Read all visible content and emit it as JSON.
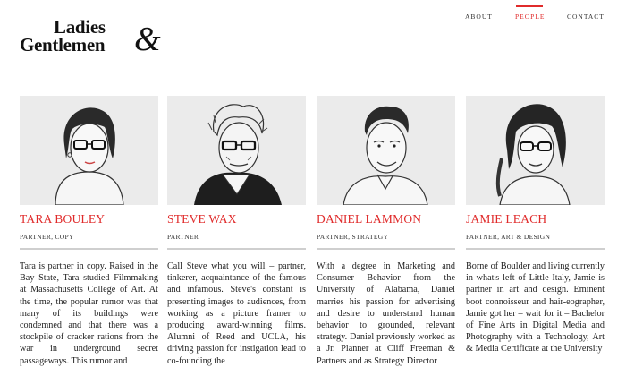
{
  "brand": {
    "line1": "Ladies",
    "line2": "Gentlemen",
    "amp": "&"
  },
  "nav": {
    "items": [
      {
        "label": "ABOUT",
        "active": false
      },
      {
        "label": "PEOPLE",
        "active": true
      },
      {
        "label": "CONTACT",
        "active": false
      }
    ]
  },
  "people": [
    {
      "name": "TARA BOULEY",
      "role": "PARTNER, COPY",
      "bio": "Tara is partner in copy. Raised in the Bay State, Tara studied Filmmaking at Massachusetts College of Art. At the time, the popular rumor was that many of its buildings were condemned and that there was a stockpile of cracker rations from the war in underground secret passageways. This rumor and"
    },
    {
      "name": "STEVE WAX",
      "role": "PARTNER",
      "bio": "Call Steve what you will – partner, tinkerer, acquaintance of the famous and infamous. Steve's constant is presenting images to audiences, from working as a picture framer to producing award-winning films. Alumni of Reed and UCLA, his driving passion for instigation lead to co-founding the"
    },
    {
      "name": "DANIEL LAMMON",
      "role": "PARTNER, STRATEGY",
      "bio": "With a degree in Marketing and Consumer Behavior from the University of Alabama, Daniel marries his passion for advertising and desire to understand human behavior to grounded, relevant strategy. Daniel previously worked as a Jr. Planner at Cliff Freeman & Partners and as Strategy Director"
    },
    {
      "name": "JAMIE LEACH",
      "role": "PARTNER, ART & DESIGN",
      "bio": "Borne of Boulder and living currently in what's left of Little Italy, Jamie is partner in art and design. Eminent boot connoisseur and hair-eographer, Jamie got her – wait for it – Bachelor of Fine Arts in Digital Media and Photography with a Technology, Art & Media Certificate at the University"
    }
  ]
}
